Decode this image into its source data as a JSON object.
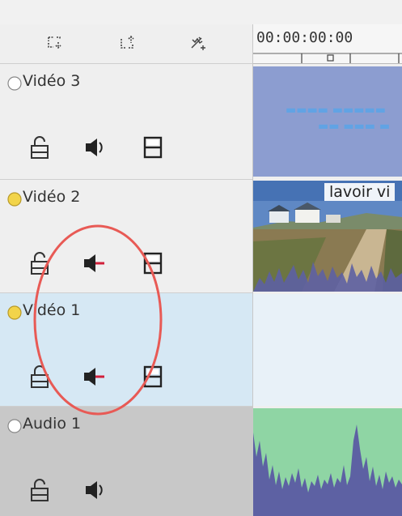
{
  "ruler": {
    "timecode": "00:00:00:00"
  },
  "tracks": [
    {
      "name": "Vidéo 3",
      "bulb_color": "#ffffff",
      "muted": false,
      "bg": "#efefef"
    },
    {
      "name": "Vidéo 2",
      "bulb_color": "#f2d44a",
      "muted": true,
      "bg": "#efefef"
    },
    {
      "name": "Vidéo 1",
      "bulb_color": "#f2d44a",
      "muted": true,
      "bg": "#d6e8f4",
      "selected": true
    },
    {
      "name": "Audio 1",
      "bulb_color": "#ffffff",
      "muted": false,
      "bg": "#c8c8c8"
    }
  ],
  "clips": {
    "video2_label": "lavoir vi"
  },
  "colors": {
    "title_clip": "#8c9dd0",
    "audio_wave_bg": "#8fd5a4",
    "audio_wave": "#5d61a3",
    "mute_mark": "#d11f3a",
    "annotation": "#e85a55"
  }
}
